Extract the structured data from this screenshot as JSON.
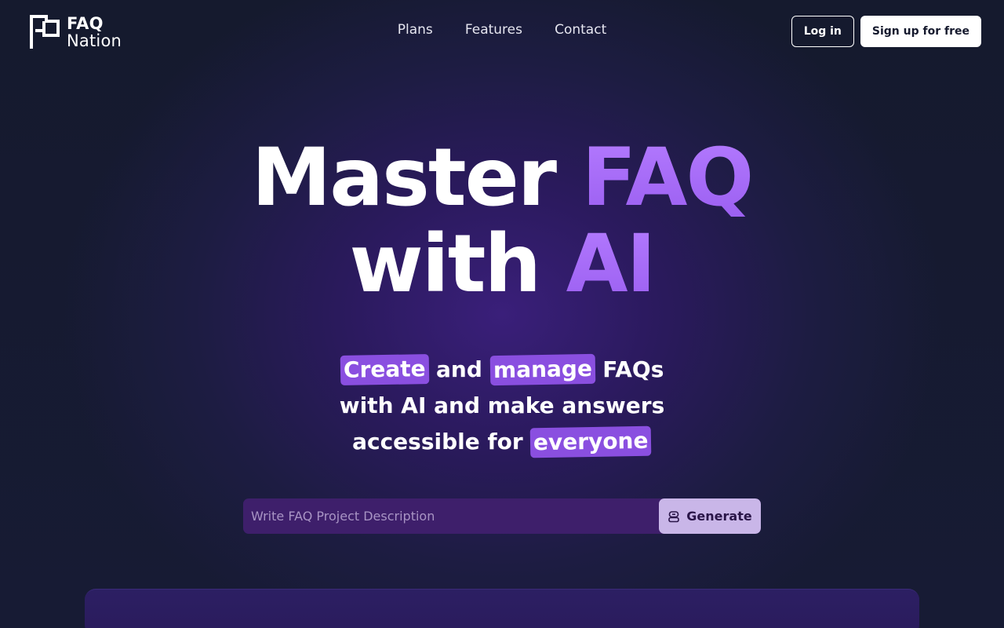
{
  "brand": {
    "name_line1": "FAQ",
    "name_line2": "Nation"
  },
  "nav": {
    "items": [
      "Plans",
      "Features",
      "Contact"
    ]
  },
  "auth": {
    "login_label": "Log in",
    "signup_label": "Sign up for free"
  },
  "hero": {
    "line1_plain": "Master ",
    "line1_accent": "FAQ",
    "line2_plain": "with ",
    "line2_accent": "AI"
  },
  "subtitle": {
    "hl1": "Create",
    "t1": " and ",
    "hl2": "manage",
    "t2": " FAQs",
    "line2": "with AI and make answers",
    "t3": "accessible for ",
    "hl3": "everyone"
  },
  "generator": {
    "placeholder": "Write FAQ Project Description",
    "button_label": "Generate",
    "button_icon": "robot-icon"
  },
  "colors": {
    "accent": "#a86cf5",
    "highlight": "#8a4fe0",
    "background": "#141a2e"
  }
}
